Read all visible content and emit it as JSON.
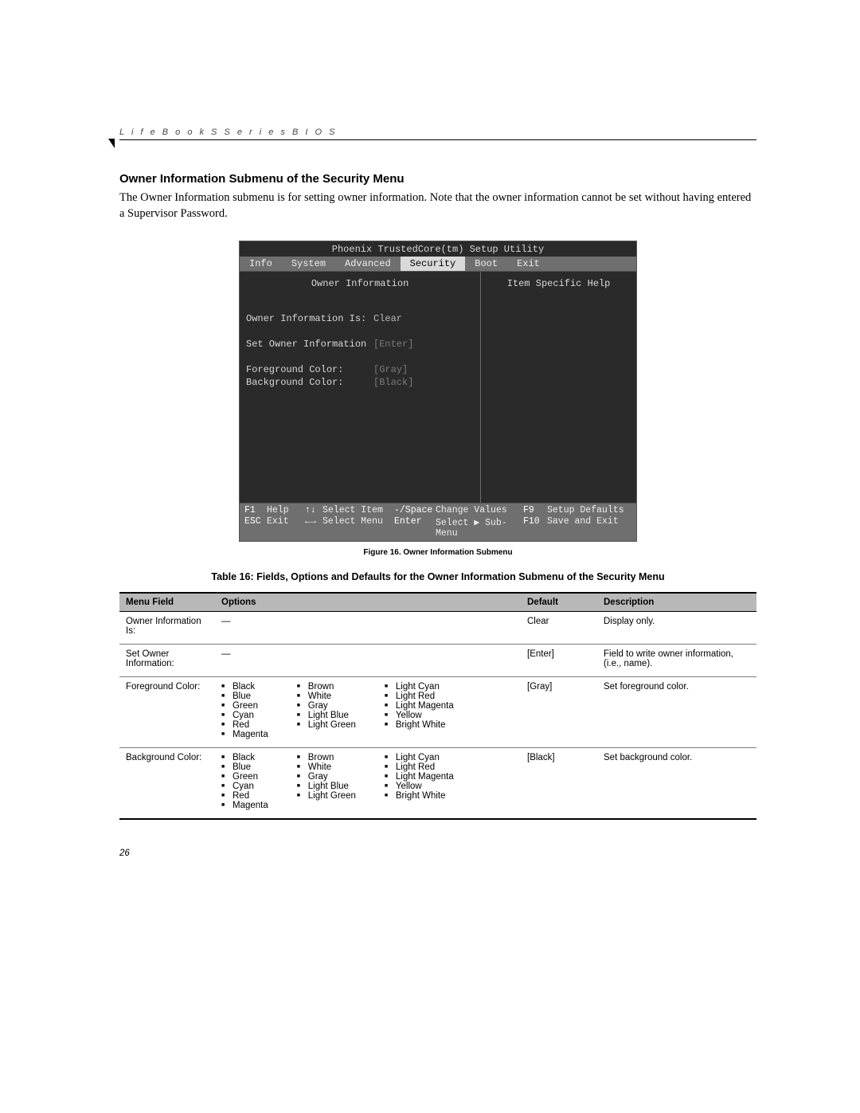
{
  "header": {
    "running": "L i f e B o o k   S   S e r i e s   B I O S"
  },
  "section": {
    "title": "Owner Information Submenu of the Security Menu",
    "body": "The Owner Information submenu is for setting owner information. Note that the owner information cannot be set without having entered a Supervisor Password."
  },
  "bios": {
    "utility_title": "Phoenix TrustedCore(tm) Setup Utility",
    "tabs": [
      "Info",
      "System",
      "Advanced",
      "Security",
      "Boot",
      "Exit"
    ],
    "active_tab_index": 3,
    "panel_left_title": "Owner Information",
    "panel_right_title": "Item Specific Help",
    "rows": [
      {
        "label": "Owner Information Is:",
        "value": "Clear",
        "muted": false
      },
      {
        "label": "Set Owner Information",
        "value": "[Enter]",
        "muted": true
      },
      {
        "label": "Foreground Color:",
        "value": "[Gray]",
        "muted": true
      },
      {
        "label": "Background Color:",
        "value": "[Black]",
        "muted": true
      }
    ],
    "footer": {
      "f1": "F1",
      "f1_text": "Help",
      "updown": "↑↓",
      "updown_text": "Select Item",
      "minus": "-/Space",
      "minus_text": "Change Values",
      "f9": "F9",
      "f9_text": "Setup Defaults",
      "esc": "ESC",
      "esc_text": "Exit",
      "lr": "←→",
      "lr_text": "Select Menu",
      "enter": "Enter",
      "enter_text": "Select ▶ Sub-Menu",
      "f10": "F10",
      "f10_text": "Save and Exit"
    }
  },
  "figure_caption": "Figure 16.   Owner Information Submenu",
  "table_caption": "Table 16: Fields, Options and Defaults for the Owner Information Submenu of the Security Menu",
  "table": {
    "headers": [
      "Menu Field",
      "Options",
      "Default",
      "Description"
    ],
    "color_options": [
      [
        "Black",
        "Blue",
        "Green",
        "Cyan",
        "Red",
        "Magenta"
      ],
      [
        "Brown",
        "White",
        "Gray",
        "Light Blue",
        "Light Green"
      ],
      [
        "Light Cyan",
        "Light Red",
        "Light Magenta",
        "Yellow",
        "Bright White"
      ]
    ],
    "rows": [
      {
        "field": "Owner Information Is:",
        "options_type": "dash",
        "default": "Clear",
        "description": "Display only."
      },
      {
        "field": "Set Owner Information:",
        "options_type": "dash",
        "default": "[Enter]",
        "description": "Field to write owner information, (i.e., name)."
      },
      {
        "field": "Foreground Color:",
        "options_type": "colors",
        "default": "[Gray]",
        "description": "Set foreground color."
      },
      {
        "field": "Background Color:",
        "options_type": "colors",
        "default": "[Black]",
        "description": "Set background color."
      }
    ]
  },
  "page_number": "26"
}
